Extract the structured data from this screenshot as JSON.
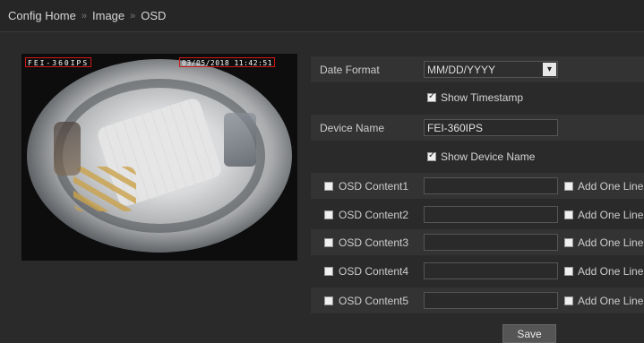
{
  "breadcrumb": {
    "items": [
      "Config Home",
      "Image",
      "OSD"
    ],
    "separator": "»"
  },
  "preview": {
    "osd_device_name": "FEI-360IPS",
    "osd_timestamp": "03/05/2018 11:42:51"
  },
  "form": {
    "date_format": {
      "label": "Date Format",
      "value": "MM/DD/YYYY"
    },
    "show_timestamp": {
      "label": "Show Timestamp",
      "checked": true
    },
    "device_name": {
      "label": "Device Name",
      "value": "FEI-360IPS"
    },
    "show_device_name": {
      "label": "Show Device Name",
      "checked": true
    },
    "osd_contents": [
      {
        "label": "OSD Content1",
        "value": "",
        "checked": false,
        "add_line_label": "Add One Line",
        "add_line_checked": false
      },
      {
        "label": "OSD Content2",
        "value": "",
        "checked": false,
        "add_line_label": "Add One Line",
        "add_line_checked": false
      },
      {
        "label": "OSD Content3",
        "value": "",
        "checked": false,
        "add_line_label": "Add One Line",
        "add_line_checked": false
      },
      {
        "label": "OSD Content4",
        "value": "",
        "checked": false,
        "add_line_label": "Add One Line",
        "add_line_checked": false
      },
      {
        "label": "OSD Content5",
        "value": "",
        "checked": false,
        "add_line_label": "Add One Line",
        "add_line_checked": false
      }
    ],
    "save_label": "Save"
  },
  "colors": {
    "background": "#2a2a2a",
    "band": "#333333",
    "osd_border": "#d01818"
  }
}
